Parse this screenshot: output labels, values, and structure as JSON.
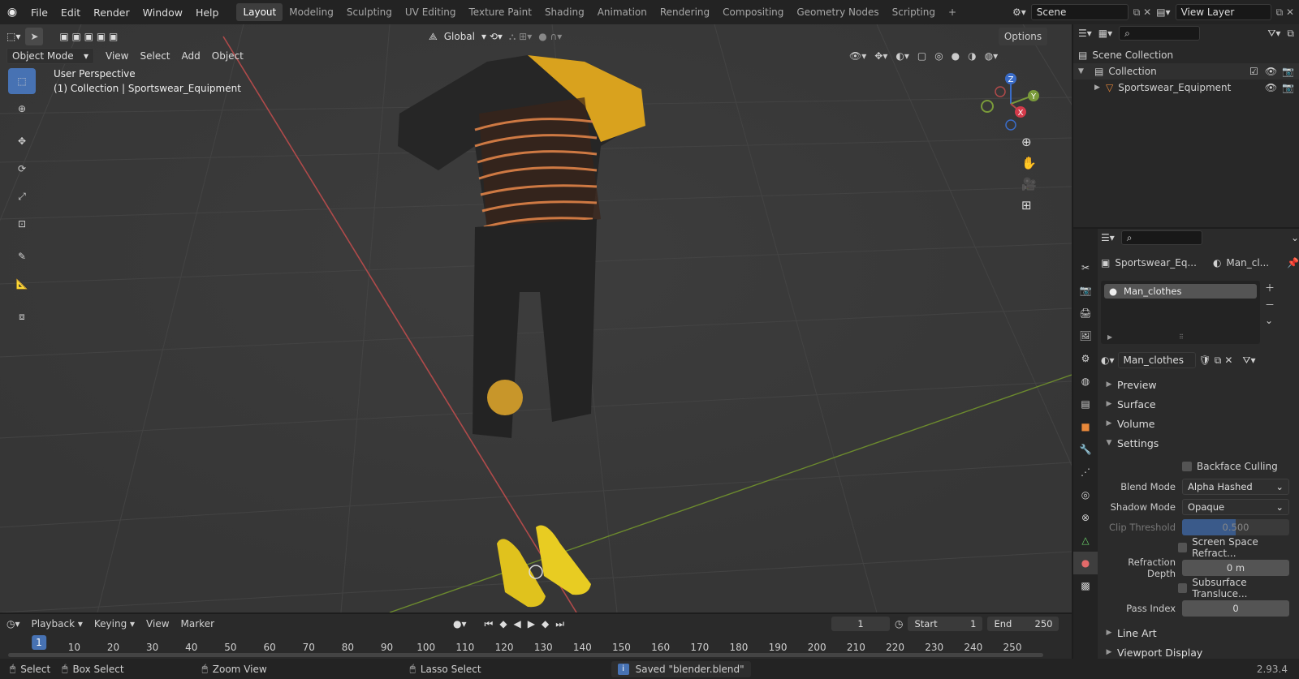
{
  "menu": [
    "File",
    "Edit",
    "Render",
    "Window",
    "Help"
  ],
  "workspaces": [
    "Layout",
    "Modeling",
    "Sculpting",
    "UV Editing",
    "Texture Paint",
    "Shading",
    "Animation",
    "Rendering",
    "Compositing",
    "Geometry Nodes",
    "Scripting"
  ],
  "scene": {
    "name": "Scene",
    "view_layer": "View Layer"
  },
  "viewport": {
    "transform_orientation": "Global",
    "options": "Options",
    "mode": "Object Mode",
    "header_menus": [
      "View",
      "Select",
      "Add",
      "Object"
    ],
    "overlay_title": "User Perspective",
    "overlay_sub": "(1) Collection | Sportswear_Equipment",
    "gizmo": {
      "z": "Z",
      "y": "Y",
      "x": "X"
    }
  },
  "outliner": {
    "root": "Scene Collection",
    "collection": "Collection",
    "object": "Sportswear_Equipment"
  },
  "properties": {
    "breadcrumb_object": "Sportswear_Eq...",
    "breadcrumb_material": "Man_cl...",
    "slot": "Man_clothes",
    "material_name": "Man_clothes",
    "sections_closed": [
      "Preview",
      "Surface",
      "Volume"
    ],
    "settings": "Settings",
    "backface": "Backface Culling",
    "blend_label": "Blend Mode",
    "blend_value": "Alpha Hashed",
    "shadow_label": "Shadow Mode",
    "shadow_value": "Opaque",
    "clip_label": "Clip Threshold",
    "clip_value": "0.500",
    "clip_fraction": 0.5,
    "ssr": "Screen Space Refract...",
    "refr_label": "Refraction Depth",
    "refr_value": "0 m",
    "sss": "Subsurface Transluce...",
    "pass_label": "Pass Index",
    "pass_value": "0",
    "sections_after": [
      "Line Art",
      "Viewport Display"
    ]
  },
  "timeline": {
    "menus": [
      "Playback",
      "Keying",
      "View",
      "Marker"
    ],
    "current": "1",
    "start_label": "Start",
    "start": "1",
    "end_label": "End",
    "end": "250",
    "ticks": [
      "1",
      "10",
      "20",
      "30",
      "40",
      "50",
      "60",
      "70",
      "80",
      "90",
      "100",
      "110",
      "120",
      "130",
      "140",
      "150",
      "160",
      "170",
      "180",
      "190",
      "200",
      "210",
      "220",
      "230",
      "240",
      "250"
    ]
  },
  "status": {
    "select": "Select",
    "box_select": "Box Select",
    "zoom": "Zoom View",
    "lasso": "Lasso Select",
    "message": "Saved \"blender.blend\"",
    "version": "2.93.4"
  },
  "colors": {
    "accent": "#4772b3",
    "x_axis": "#b04a4a",
    "y_axis": "#7a9a3a"
  }
}
